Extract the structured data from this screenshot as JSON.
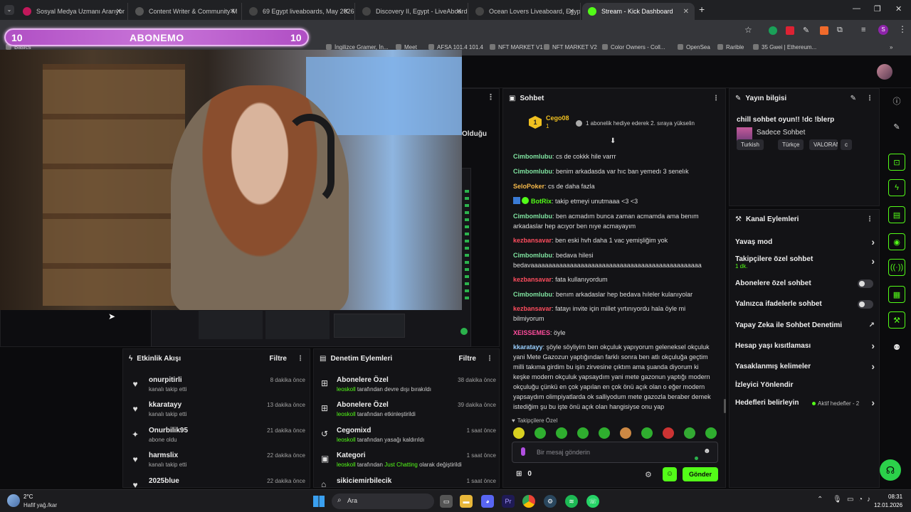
{
  "browser": {
    "tabs": [
      {
        "title": "Sosyal Medya Uzmanı Ararıyor",
        "color": "#c2185b"
      },
      {
        "title": "Content Writer & Community M",
        "color": "#555"
      },
      {
        "title": "69 Egypt liveaboards, May 2026",
        "color": "#444"
      },
      {
        "title": "Discovery II, Egypt - LiveAboard",
        "color": "#444"
      },
      {
        "title": "Ocean Lovers Liveaboard, Egypt",
        "color": "#444"
      },
      {
        "title": "Stream - Kick Dashboard",
        "color": "#53fc18"
      }
    ],
    "bookmarks": [
      "Basics",
      "İngilizce Gramer, İn...",
      "Meet",
      "AFSA 101.4 101.4",
      "NFT MARKET V1",
      "NFT MARKET V2",
      "Color Owners - Coll...",
      "OpenSea",
      "Rarible",
      "35 Gwei | Ethereum..."
    ]
  },
  "overlay": {
    "banner_text": "ABONEMO",
    "left_num": "10",
    "right_num": "10"
  },
  "partial_label": "Olduğu",
  "chat": {
    "title": "Sohbet",
    "pinned_user": "Cego08",
    "pinned_rank": "1",
    "pinned_msg": "1 abonelik hediye ederek 2. sıraya yükselin",
    "messages": [
      {
        "user": "Cimbomlubu",
        "color": "#7fe3a0",
        "text": "cs de cokkk hile varrr"
      },
      {
        "user": "Cimbomlubu",
        "color": "#7fe3a0",
        "text": "benim arkadasda var hıc ban yemedı 3 senelık"
      },
      {
        "user": "SeloPoker",
        "color": "#f6b94a",
        "text": "cs de daha fazla"
      },
      {
        "user": "BotRix",
        "color": "#53fc18",
        "text": "takip etmeyi unutmaaa <3 <3"
      },
      {
        "user": "Cimbomlubu",
        "color": "#7fe3a0",
        "text": "ben acmadım bunca zaman acmamda ama benım arkadaslar hep acıyor ben nıye acmayayım"
      },
      {
        "user": "kezbansavar",
        "color": "#ff4d5e",
        "text": "ben eski hvh daha 1 vac yemişliğim yok"
      },
      {
        "user": "Cimbomlubu",
        "color": "#7fe3a0",
        "text": "bedava hilesi bedavaaaaaaaaaaaaaaaaaaaaaaaaaaaaaaaaaaaaaaaaaaaaaaaa"
      },
      {
        "user": "kezbansavar",
        "color": "#ff4d5e",
        "text": "fata kullanıyordum"
      },
      {
        "user": "Cimbomlubu",
        "color": "#7fe3a0",
        "text": "benım arkadaslar hep bedava hıleler kulanıyolar"
      },
      {
        "user": "kezbansavar",
        "color": "#ff4d5e",
        "text": "fatayı invite için millet yırtınıyordu hala öyle mi bilmiyorum"
      },
      {
        "user": "XEISSEMES",
        "color": "#ff4d9d",
        "text": "öyle"
      },
      {
        "user": "kkaratayy",
        "color": "#9ad0ff",
        "text": "şöyle söyliyim ben okçuluk yapıyorum geleneksel okçuluk yani Mete Gazozun yaptığından farklı sonra ben atlı okçuluğa geçtim milli takıma girdim bu işin zirvesine çıktım ama şuanda diyorum ki keşke modern okçuluk yapsaydım yani mete gazonun yaptığı modern okçuluğu çünkü en çok yapılan en çok önü açık olan o eğer modern yapsaydım olimpiyatlarda ok salliyodum mete gazozla beraber demek istediğim şu bu işte önü açık olan hangisiyse onu yap"
      }
    ],
    "followers_only": "Takipçilere Özel",
    "input_placeholder": "Bir mesaj gönderin",
    "count": "0",
    "send_label": "Gönder"
  },
  "stream_info": {
    "title": "Yayın bilgisi",
    "stream_title": "chill sohbet oyun!! !dc !blerp",
    "category": "Sadece Sohbet",
    "tags": [
      "Turkish",
      "Türkçe",
      "VALORANT",
      "c"
    ]
  },
  "channel_actions": {
    "title": "Kanal Eylemleri",
    "items": [
      {
        "label": "Yavaş mod",
        "sub": "",
        "ctl": "chev"
      },
      {
        "label": "Takipçilere özel sohbet",
        "sub": "1 dk.",
        "ctl": "chev"
      },
      {
        "label": "Abonelere özel sohbet",
        "sub": "",
        "ctl": "toggle"
      },
      {
        "label": "Yalnızca ifadelerle sohbet",
        "sub": "",
        "ctl": "toggle"
      },
      {
        "label": "Yapay Zeka ile Sohbet Denetimi",
        "sub": "",
        "ctl": "ext"
      },
      {
        "label": "Hesap yaşı kısıtlaması",
        "sub": "",
        "ctl": "chev"
      },
      {
        "label": "Yasaklanmış kelimeler",
        "sub": "",
        "ctl": "chev"
      },
      {
        "label": "İzleyici Yönlendir",
        "sub": "",
        "ctl": "none"
      },
      {
        "label": "Hedefleri belirleyin",
        "sub": "",
        "ctl": "chev"
      }
    ],
    "goals_status": "Aktif hedefler - 2"
  },
  "activity": {
    "title": "Etkinlik Akışı",
    "filter": "Filtre",
    "items": [
      {
        "name": "onurpitirli",
        "sub": "kanalı takip etti",
        "time": "8 dakika önce",
        "icon": "♥"
      },
      {
        "name": "kkaratayy",
        "sub": "kanalı takip etti",
        "time": "13 dakika önce",
        "icon": "♥"
      },
      {
        "name": "Onurbilik95",
        "sub": "abone oldu",
        "time": "21 dakika önce",
        "icon": "✦"
      },
      {
        "name": "harmslix",
        "sub": "kanalı takip etti",
        "time": "22 dakika önce",
        "icon": "♥"
      },
      {
        "name": "2025blue",
        "sub": "",
        "time": "22 dakika önce",
        "icon": "♥"
      }
    ]
  },
  "moderation": {
    "title": "Denetim Eylemleri",
    "filter": "Filtre",
    "items": [
      {
        "name": "Abonelere Özel",
        "actor": "leoskoll",
        "rest": "tarafından devre dışı bırakıldı",
        "extra": "",
        "tail": "",
        "time": "38 dakika önce",
        "icon": "⊞"
      },
      {
        "name": "Abonelere Özel",
        "actor": "leoskoll",
        "rest": "tarafından etkinleştirildi",
        "extra": "",
        "tail": "",
        "time": "39 dakika önce",
        "icon": "⊞"
      },
      {
        "name": "Cegomixd",
        "actor": "leoskoll",
        "rest": "tarafından yasağı kaldırıldı",
        "extra": "",
        "tail": "",
        "time": "1 saat önce",
        "icon": "↺"
      },
      {
        "name": "Kategori",
        "actor": "leoskoll",
        "rest": "tarafından",
        "extra": "Just Chatting",
        "tail": "olarak değiştirildi",
        "time": "1 saat önce",
        "icon": "▣"
      },
      {
        "name": "sikiciemirbilecik",
        "actor": "",
        "rest": "",
        "extra": "",
        "tail": "",
        "time": "1 saat önce",
        "icon": "⌂"
      }
    ]
  },
  "taskbar": {
    "weather_temp": "2°C",
    "weather_desc": "Hafif yağ./kar",
    "search": "Ara",
    "time": "08:31",
    "date": "12.01.2026"
  }
}
